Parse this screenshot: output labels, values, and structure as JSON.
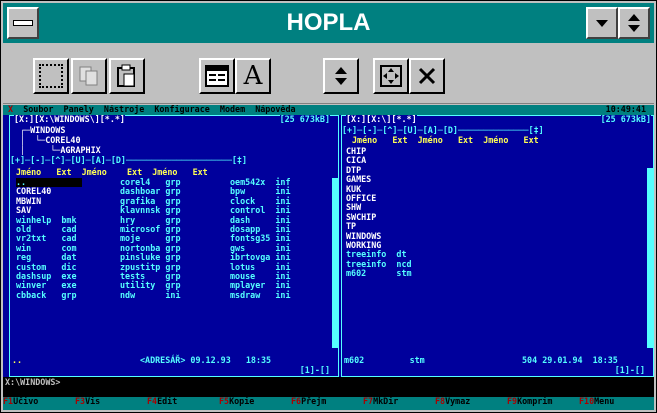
{
  "window": {
    "title": "HOPLA"
  },
  "menu": {
    "items": [
      "Soubor",
      "Panely",
      "Nástroje",
      "Konfigurace",
      "Modem",
      "Nápověda"
    ],
    "clock": "10:49:41"
  },
  "left_panel": {
    "path": "X:\\WINDOWS\\",
    "mask": "*.*",
    "size": "25 673kB",
    "tree": [
      "WINDOWS",
      "COREL40",
      "AGRAPHIX"
    ],
    "col_headers": [
      "Jméno",
      "Ext",
      "Jméno",
      "Ext",
      "Jméno",
      "Ext"
    ],
    "col1": [
      [
        "..",
        ""
      ],
      [
        "COREL40",
        ""
      ],
      [
        "MBWIN",
        ""
      ],
      [
        "SAV",
        ""
      ],
      [
        "winhelp",
        "bmk"
      ],
      [
        "old",
        "cad"
      ],
      [
        "vr2txt",
        "cad"
      ],
      [
        "win",
        "com"
      ],
      [
        "reg",
        "dat"
      ],
      [
        "custom",
        "dic"
      ],
      [
        "dashsup",
        "exe"
      ],
      [
        "winver",
        "exe"
      ],
      [
        "cbback",
        "grp"
      ]
    ],
    "col2": [
      [
        "corel4",
        "grp"
      ],
      [
        "dashboar",
        "grp"
      ],
      [
        "grafika",
        "grp"
      ],
      [
        "klavnnsk",
        "grp"
      ],
      [
        "hry",
        "grp"
      ],
      [
        "microsof",
        "grp"
      ],
      [
        "moje",
        "grp"
      ],
      [
        "nortonba",
        "grp"
      ],
      [
        "pinsluke",
        "grp"
      ],
      [
        "zpustitp",
        "grp"
      ],
      [
        "tests",
        "grp"
      ],
      [
        "utility",
        "grp"
      ],
      [
        "ndw",
        "ini"
      ]
    ],
    "col3": [
      [
        "oem542x",
        "inf"
      ],
      [
        "bpw",
        "ini"
      ],
      [
        "clock",
        "ini"
      ],
      [
        "control",
        "ini"
      ],
      [
        "dash",
        "ini"
      ],
      [
        "dosapp",
        "ini"
      ],
      [
        "fontsg35",
        "ini"
      ],
      [
        "gws",
        "ini"
      ],
      [
        "ibrtovga",
        "ini"
      ],
      [
        "lotus",
        "ini"
      ],
      [
        "mouse",
        "ini"
      ],
      [
        "mplayer",
        "ini"
      ],
      [
        "msdraw",
        "ini"
      ]
    ],
    "status": "<ADRESÁŘ> 09.12.93   18:35",
    "footer": "[1]-[]"
  },
  "right_panel": {
    "path": "X:\\",
    "mask": "*.*",
    "size": "25 673kB",
    "col_headers": [
      "Jméno",
      "Ext",
      "Jméno",
      "Ext",
      "Jméno",
      "Ext"
    ],
    "entries": [
      [
        "CHIP",
        ""
      ],
      [
        "CICA",
        ""
      ],
      [
        "DTP",
        ""
      ],
      [
        "GAMES",
        ""
      ],
      [
        "KUK",
        ""
      ],
      [
        "OFFICE",
        ""
      ],
      [
        "SHW",
        ""
      ],
      [
        "SWCHIP",
        ""
      ],
      [
        "TP",
        ""
      ],
      [
        "WINDOWS",
        ""
      ],
      [
        "WORKING",
        ""
      ],
      [
        "treeinfo",
        "dt"
      ],
      [
        "treeinfo",
        "ncd"
      ],
      [
        "m602",
        "stm"
      ]
    ],
    "status_name": "m602",
    "status_ext": "stm",
    "status_size": "504",
    "status_date": "29.01.94",
    "status_time": "18:35",
    "footer": "[1]-[]"
  },
  "command_line": "X:\\WINDOWS>",
  "fkeys": [
    {
      "n": "1",
      "label": "Učivo"
    },
    {
      "n": "3",
      "label": "Vis"
    },
    {
      "n": "4",
      "label": "Edit"
    },
    {
      "n": "5",
      "label": "Kopie"
    },
    {
      "n": "6",
      "label": "Přejm"
    },
    {
      "n": "7",
      "label": "MkDir"
    },
    {
      "n": "8",
      "label": "Vymaz"
    },
    {
      "n": "9",
      "label": "Komprim"
    },
    {
      "n": "10",
      "label": "Menu"
    }
  ]
}
